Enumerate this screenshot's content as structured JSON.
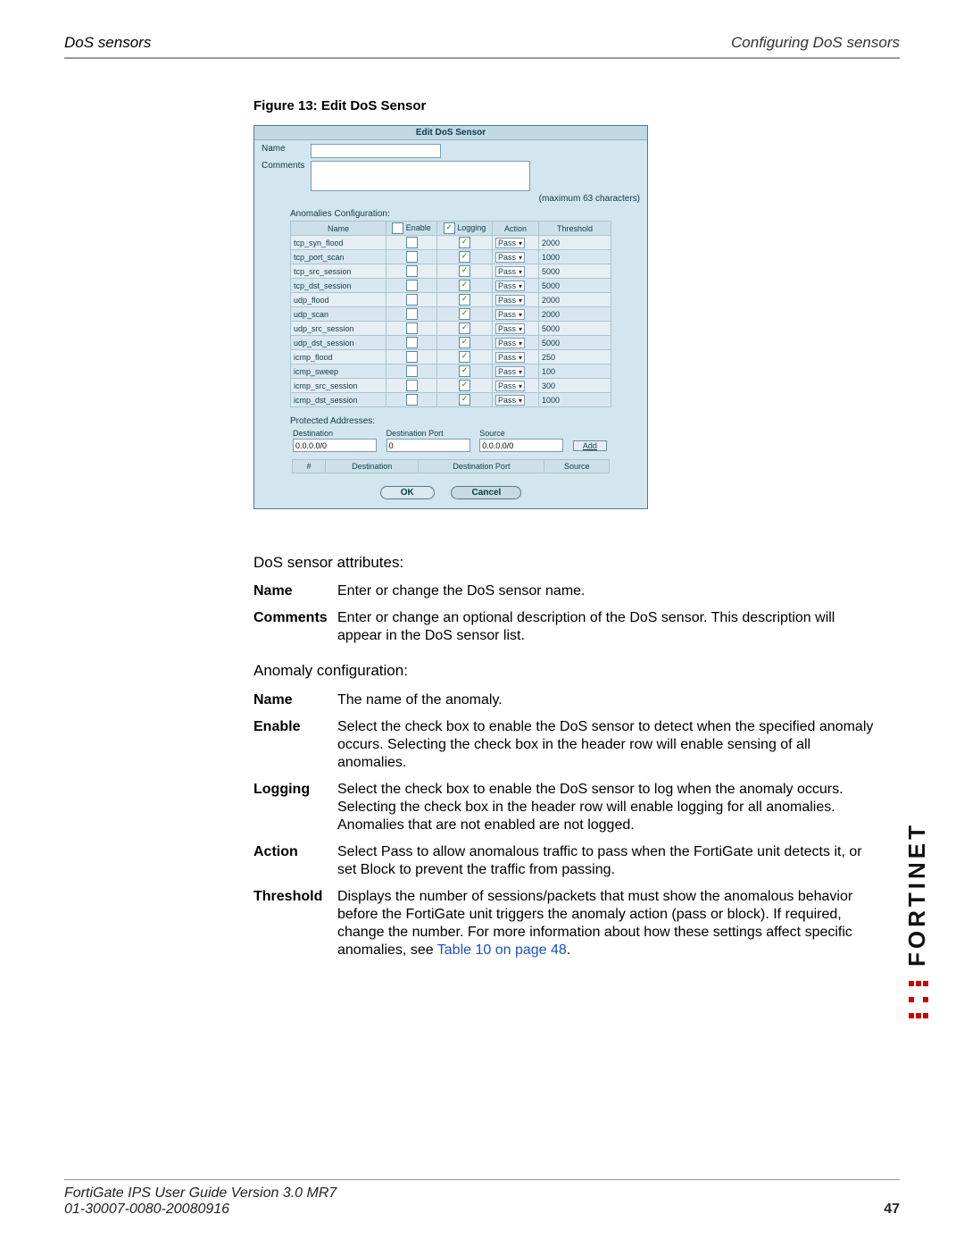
{
  "header": {
    "left": "DoS sensors",
    "right": "Configuring DoS sensors"
  },
  "figure_caption": "Figure 13: Edit DoS Sensor",
  "shot": {
    "title": "Edit DoS Sensor",
    "name_label": "Name",
    "comments_label": "Comments",
    "max_chars": "(maximum 63 characters)",
    "anom_label": "Anomalies Configuration:",
    "columns": {
      "name": "Name",
      "enable": "Enable",
      "logging": "Logging",
      "action": "Action",
      "threshold": "Threshold"
    },
    "header_enable_checked": false,
    "header_logging_checked": true,
    "rows": [
      {
        "name": "tcp_syn_flood",
        "enable": false,
        "logging": true,
        "action": "Pass",
        "threshold": "2000"
      },
      {
        "name": "tcp_port_scan",
        "enable": false,
        "logging": true,
        "action": "Pass",
        "threshold": "1000"
      },
      {
        "name": "tcp_src_session",
        "enable": false,
        "logging": true,
        "action": "Pass",
        "threshold": "5000"
      },
      {
        "name": "tcp_dst_session",
        "enable": false,
        "logging": true,
        "action": "Pass",
        "threshold": "5000"
      },
      {
        "name": "udp_flood",
        "enable": false,
        "logging": true,
        "action": "Pass",
        "threshold": "2000"
      },
      {
        "name": "udp_scan",
        "enable": false,
        "logging": true,
        "action": "Pass",
        "threshold": "2000"
      },
      {
        "name": "udp_src_session",
        "enable": false,
        "logging": true,
        "action": "Pass",
        "threshold": "5000"
      },
      {
        "name": "udp_dst_session",
        "enable": false,
        "logging": true,
        "action": "Pass",
        "threshold": "5000"
      },
      {
        "name": "icmp_flood",
        "enable": false,
        "logging": true,
        "action": "Pass",
        "threshold": "250"
      },
      {
        "name": "icmp_sweep",
        "enable": false,
        "logging": true,
        "action": "Pass",
        "threshold": "100"
      },
      {
        "name": "icmp_src_session",
        "enable": false,
        "logging": true,
        "action": "Pass",
        "threshold": "300"
      },
      {
        "name": "icmp_dst_session",
        "enable": false,
        "logging": true,
        "action": "Pass",
        "threshold": "1000"
      }
    ],
    "protected_label": "Protected Addresses:",
    "protected_fields": {
      "dest_label": "Destination",
      "dest_value": "0.0.0.0/0",
      "port_label": "Destination Port",
      "port_value": "0",
      "src_label": "Source",
      "src_value": "0.0.0.0/0",
      "add": "Add"
    },
    "protected_cols": {
      "num": "#",
      "dest": "Destination",
      "port": "Destination Port",
      "src": "Source"
    },
    "ok": "OK",
    "cancel": "Cancel"
  },
  "sections": {
    "attributes_title": "DoS sensor attributes:",
    "attributes": [
      {
        "term": "Name",
        "desc": "Enter or change the DoS sensor name."
      },
      {
        "term": "Comments",
        "desc": "Enter or change an optional description of the DoS sensor. This description will appear in the DoS sensor list."
      }
    ],
    "anomaly_title": "Anomaly configuration:",
    "anomaly": [
      {
        "term": "Name",
        "desc": "The name of the anomaly."
      },
      {
        "term": "Enable",
        "desc": "Select the check box to enable the DoS sensor to detect when the specified anomaly occurs. Selecting the check box in the header row will enable sensing of all anomalies."
      },
      {
        "term": "Logging",
        "desc": "Select the check box to enable the DoS sensor to log when the anomaly occurs. Selecting the check box in the header row will enable logging for all anomalies. Anomalies that are not enabled are not logged."
      },
      {
        "term": "Action",
        "desc": "Select Pass to allow anomalous traffic to pass when the FortiGate unit detects it, or set Block to prevent the traffic from passing."
      },
      {
        "term": "Threshold",
        "desc": "Displays the number of sessions/packets that must show the anomalous behavior before the FortiGate unit triggers the anomaly action (pass or block). If required, change the number. For more information about how these settings affect specific anomalies, see ",
        "link": "Table 10 on page 48",
        "tail": "."
      }
    ]
  },
  "footer": {
    "line1": "FortiGate IPS User Guide Version 3.0 MR7",
    "line2": "01-30007-0080-20080916",
    "page": "47"
  },
  "logo_text": "FORTINET"
}
